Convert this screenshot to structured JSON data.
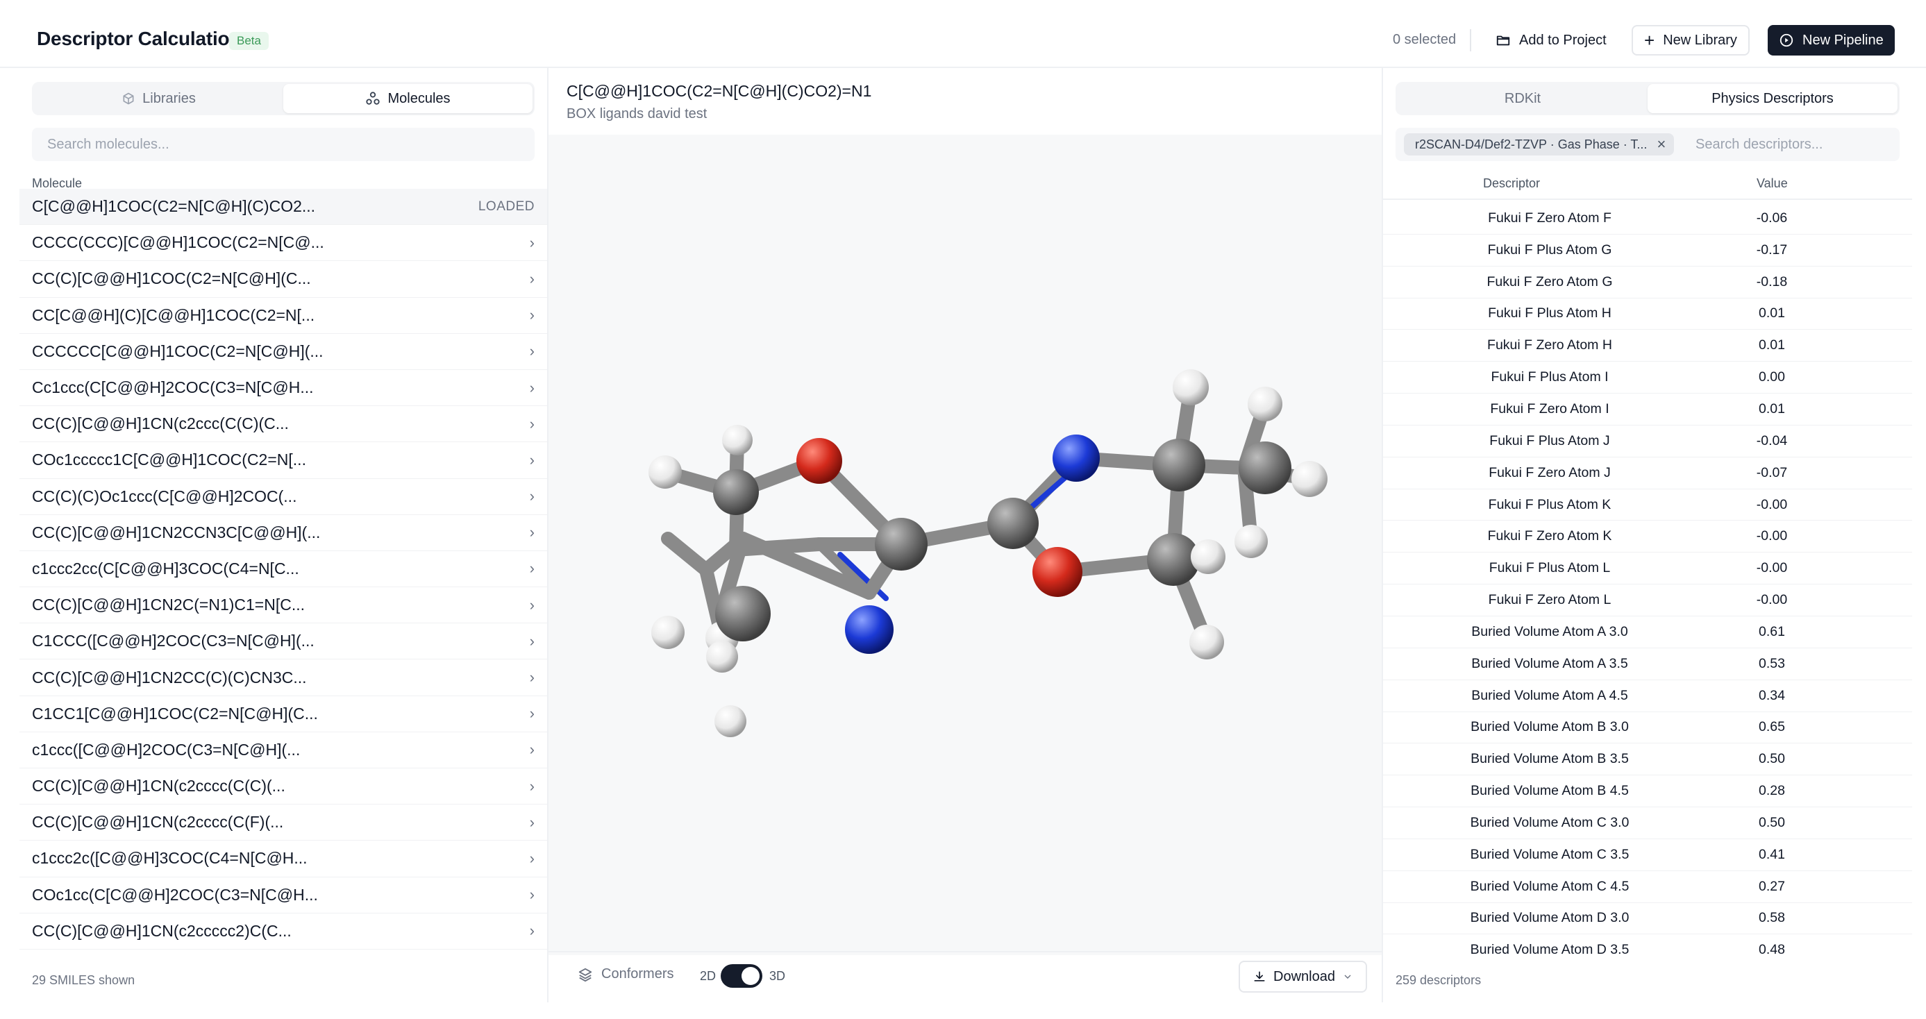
{
  "app": {
    "title": "Descriptor Calculation",
    "beta_badge": "Beta",
    "selected_count": "0 selected",
    "add_to_project": "Add to Project",
    "new_library": "New Library",
    "new_pipeline": "New Pipeline"
  },
  "left": {
    "tabs": [
      {
        "label": "Libraries",
        "icon": "cube-icon"
      },
      {
        "label": "Molecules",
        "icon": "molecules-icon",
        "active": true
      }
    ],
    "search_placeholder": "Search molecules...",
    "column_header": "Molecule",
    "molecules": [
      {
        "smiles": "C[C@@H]1COC(C2=N[C@H](C)CO2...",
        "status": "LOADED"
      },
      {
        "smiles": "CCCC(CCC)[C@@H]1COC(C2=N[C@..."
      },
      {
        "smiles": "CC(C)[C@@H]1COC(C2=N[C@H](C..."
      },
      {
        "smiles": "CC[C@@H](C)[C@@H]1COC(C2=N[..."
      },
      {
        "smiles": "CCCCCC[C@@H]1COC(C2=N[C@H](..."
      },
      {
        "smiles": "Cc1ccc(C[C@@H]2COC(C3=N[C@H..."
      },
      {
        "smiles": "CC(C)[C@@H]1CN(c2ccc(C(C)(C..."
      },
      {
        "smiles": "COc1ccccc1C[C@@H]1COC(C2=N[..."
      },
      {
        "smiles": "CC(C)(C)Oc1ccc(C[C@@H]2COC(..."
      },
      {
        "smiles": "CC(C)[C@@H]1CN2CCN3C[C@@H](..."
      },
      {
        "smiles": "c1ccc2cc(C[C@@H]3COC(C4=N[C..."
      },
      {
        "smiles": "CC(C)[C@@H]1CN2C(=N1)C1=N[C..."
      },
      {
        "smiles": "C1CCC([C@@H]2COC(C3=N[C@H](..."
      },
      {
        "smiles": "CC(C)[C@@H]1CN2CC(C)(C)CN3C..."
      },
      {
        "smiles": "C1CC1[C@@H]1COC(C2=N[C@H](C..."
      },
      {
        "smiles": "c1ccc([C@@H]2COC(C3=N[C@H](..."
      },
      {
        "smiles": "CC(C)[C@@H]1CN(c2cccc(C(C)(..."
      },
      {
        "smiles": "CC(C)[C@@H]1CN(c2cccc(C(F)(..."
      },
      {
        "smiles": "c1ccc2c([C@@H]3COC(C4=N[C@H..."
      },
      {
        "smiles": "COc1cc(C[C@@H]2COC(C3=N[C@H..."
      },
      {
        "smiles": "CC(C)[C@@H]1CN(c2ccccc2)C(C..."
      }
    ],
    "footer": "29 SMILES shown"
  },
  "center": {
    "smiles": "C[C@@H]1COC(C2=N[C@H](C)CO2)=N1",
    "library": "BOX ligands david test",
    "conformers_label": "Conformers",
    "toggle_2d": "2D",
    "toggle_3d": "3D",
    "download_label": "Download"
  },
  "right": {
    "tabs": [
      {
        "label": "RDKit"
      },
      {
        "label": "Physics Descriptors",
        "active": true
      }
    ],
    "filter_chip": "r2SCAN-D4/Def2-TZVP · Gas Phase · T...",
    "search_placeholder": "Search descriptors...",
    "col_descriptor": "Descriptor",
    "col_value": "Value",
    "descriptors": [
      {
        "name": "Fukui F Zero Atom F",
        "value": "-0.06"
      },
      {
        "name": "Fukui F Plus Atom G",
        "value": "-0.17"
      },
      {
        "name": "Fukui F Zero Atom G",
        "value": "-0.18"
      },
      {
        "name": "Fukui F Plus Atom H",
        "value": "0.01"
      },
      {
        "name": "Fukui F Zero Atom H",
        "value": "0.01"
      },
      {
        "name": "Fukui F Plus Atom I",
        "value": "0.00"
      },
      {
        "name": "Fukui F Zero Atom I",
        "value": "0.01"
      },
      {
        "name": "Fukui F Plus Atom J",
        "value": "-0.04"
      },
      {
        "name": "Fukui F Zero Atom J",
        "value": "-0.07"
      },
      {
        "name": "Fukui F Plus Atom K",
        "value": "-0.00"
      },
      {
        "name": "Fukui F Zero Atom K",
        "value": "-0.00"
      },
      {
        "name": "Fukui F Plus Atom L",
        "value": "-0.00"
      },
      {
        "name": "Fukui F Zero Atom L",
        "value": "-0.00"
      },
      {
        "name": "Buried Volume Atom A 3.0",
        "value": "0.61"
      },
      {
        "name": "Buried Volume Atom A 3.5",
        "value": "0.53"
      },
      {
        "name": "Buried Volume Atom A 4.5",
        "value": "0.34"
      },
      {
        "name": "Buried Volume Atom B 3.0",
        "value": "0.65"
      },
      {
        "name": "Buried Volume Atom B 3.5",
        "value": "0.50"
      },
      {
        "name": "Buried Volume Atom B 4.5",
        "value": "0.28"
      },
      {
        "name": "Buried Volume Atom C 3.0",
        "value": "0.50"
      },
      {
        "name": "Buried Volume Atom C 3.5",
        "value": "0.41"
      },
      {
        "name": "Buried Volume Atom C 4.5",
        "value": "0.27"
      },
      {
        "name": "Buried Volume Atom D 3.0",
        "value": "0.58"
      },
      {
        "name": "Buried Volume Atom D 3.5",
        "value": "0.48"
      }
    ],
    "footer": "259 descriptors"
  },
  "colors": {
    "accent_dark": "#151c2b",
    "beta_green": "#3a9a58",
    "carbon": "#6f6f6f",
    "oxygen": "#d42a1c",
    "nitrogen": "#1c3ad6",
    "hydrogen": "#f2f2f2"
  }
}
